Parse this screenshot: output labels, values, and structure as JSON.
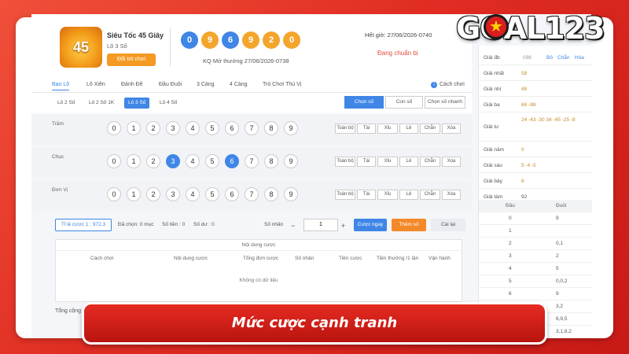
{
  "brand": {
    "logo_text": "GOAL123",
    "banner": "Mức cược cạnh tranh"
  },
  "game": {
    "logo": "45",
    "title": "Siêu Tốc 45 Giây",
    "subtitle": "Lô 3 Số",
    "switch_label": "Đổi trò chơi",
    "balls": [
      "0",
      "9",
      "6",
      "9",
      "2",
      "0"
    ],
    "draw_info": "KQ Mở thưởng 27/06/2026-0738",
    "deadline": "Hết giờ: 27/06/2026-0740",
    "status": "Đang chuẩn bị"
  },
  "results": {
    "header": [
      "Giải đb",
      "098",
      "Bô",
      "Chẵn",
      "Hòa"
    ],
    "rows": [
      {
        "label": "Giải nhất",
        "value": "58"
      },
      {
        "label": "Giải nhì",
        "value": "48"
      },
      {
        "label": "Giải ba",
        "value": "68   -88"
      },
      {
        "label": "Giải tư",
        "value": "24  -43   -30   34  -45  -25   -8"
      },
      {
        "label": "Giải năm",
        "value": "0"
      },
      {
        "label": "Giải sáu",
        "value": "5   -4   -5"
      },
      {
        "label": "Giải bảy",
        "value": "8"
      },
      {
        "label": "Giải tám",
        "value": "92"
      }
    ],
    "head_dau": "Đầu",
    "head_duoi": "Đuôi",
    "dau_duoi": [
      [
        "0",
        "9"
      ],
      [
        "1",
        ""
      ],
      [
        "2",
        "0,1"
      ],
      [
        "3",
        "2"
      ],
      [
        "4",
        "5"
      ],
      [
        "5",
        "0,0,2"
      ],
      [
        "6",
        "9"
      ],
      [
        "7",
        "3,2"
      ],
      [
        "8",
        "6,9,5"
      ],
      [
        "9",
        "3,1,8,2"
      ]
    ]
  },
  "tabs": [
    "Bao Lô",
    "Lô Xiên",
    "Đánh Đề",
    "Đầu Đuôi",
    "3 Càng",
    "4 Càng",
    "Trò Chơi Thú Vị"
  ],
  "how_to": "Cách chơi",
  "sub_tabs": [
    "Lô 2 Số",
    "Lô 2 Số 1K",
    "Lô 3 Số",
    "Lô 4 Số"
  ],
  "modes": [
    "Chọn số",
    "Con số",
    "Chọn số nhanh"
  ],
  "pick_rows": [
    {
      "label": "Trăm",
      "selected": []
    },
    {
      "label": "Chục",
      "selected": [
        3,
        6
      ]
    },
    {
      "label": "Đơn Vị",
      "selected": []
    }
  ],
  "digits": [
    "0",
    "1",
    "2",
    "3",
    "4",
    "5",
    "6",
    "7",
    "8",
    "9"
  ],
  "quick": [
    "Toàn bộ",
    "Tài",
    "Xỉu",
    "Lẻ",
    "Chẵn",
    "Xóa"
  ],
  "bet": {
    "rate": "Tỉ lệ cược 1 : 972.3",
    "selected": "Đã chọn: 0 mục",
    "amount": "Số tiền : 0",
    "balance": "Số dư : 0",
    "mult_label": "Số nhân",
    "minus": "−",
    "mult": "1",
    "plus": "+",
    "bet_now": "Cược ngay",
    "add": "Thêm số",
    "reset": "Cài lại"
  },
  "table": {
    "title": "Nội dung cược",
    "cols": [
      "Cách chơi",
      "Nội dung cược",
      "Tổng đơn cược",
      "Số nhân",
      "Tiền cược",
      "Tiền thưởng /1 lần",
      "Vận hành"
    ],
    "empty": "Không có dữ liệu",
    "total": "Tổng cộng"
  },
  "colors": {
    "accent": "#3f86e6",
    "orange": "#f4a52c",
    "brand_red": "#e02c22"
  }
}
